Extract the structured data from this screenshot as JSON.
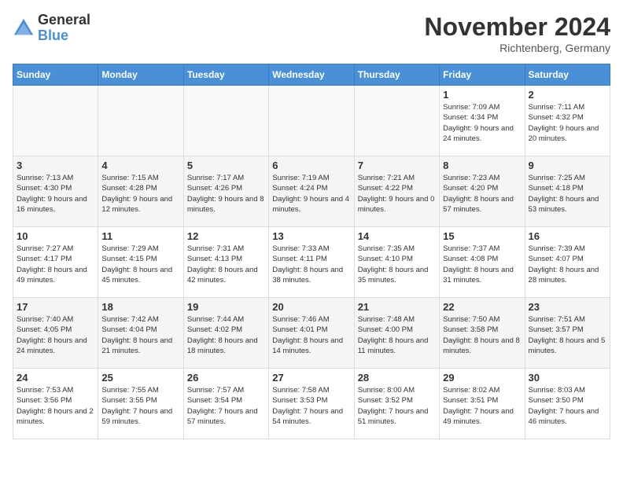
{
  "logo": {
    "general": "General",
    "blue": "Blue"
  },
  "title": "November 2024",
  "location": "Richtenberg, Germany",
  "days_header": [
    "Sunday",
    "Monday",
    "Tuesday",
    "Wednesday",
    "Thursday",
    "Friday",
    "Saturday"
  ],
  "weeks": [
    {
      "days": [
        {
          "num": "",
          "empty": true
        },
        {
          "num": "",
          "empty": true
        },
        {
          "num": "",
          "empty": true
        },
        {
          "num": "",
          "empty": true
        },
        {
          "num": "",
          "empty": true
        },
        {
          "num": "1",
          "sunrise": "Sunrise: 7:09 AM",
          "sunset": "Sunset: 4:34 PM",
          "daylight": "Daylight: 9 hours and 24 minutes."
        },
        {
          "num": "2",
          "sunrise": "Sunrise: 7:11 AM",
          "sunset": "Sunset: 4:32 PM",
          "daylight": "Daylight: 9 hours and 20 minutes."
        }
      ]
    },
    {
      "days": [
        {
          "num": "3",
          "sunrise": "Sunrise: 7:13 AM",
          "sunset": "Sunset: 4:30 PM",
          "daylight": "Daylight: 9 hours and 16 minutes."
        },
        {
          "num": "4",
          "sunrise": "Sunrise: 7:15 AM",
          "sunset": "Sunset: 4:28 PM",
          "daylight": "Daylight: 9 hours and 12 minutes."
        },
        {
          "num": "5",
          "sunrise": "Sunrise: 7:17 AM",
          "sunset": "Sunset: 4:26 PM",
          "daylight": "Daylight: 9 hours and 8 minutes."
        },
        {
          "num": "6",
          "sunrise": "Sunrise: 7:19 AM",
          "sunset": "Sunset: 4:24 PM",
          "daylight": "Daylight: 9 hours and 4 minutes."
        },
        {
          "num": "7",
          "sunrise": "Sunrise: 7:21 AM",
          "sunset": "Sunset: 4:22 PM",
          "daylight": "Daylight: 9 hours and 0 minutes."
        },
        {
          "num": "8",
          "sunrise": "Sunrise: 7:23 AM",
          "sunset": "Sunset: 4:20 PM",
          "daylight": "Daylight: 8 hours and 57 minutes."
        },
        {
          "num": "9",
          "sunrise": "Sunrise: 7:25 AM",
          "sunset": "Sunset: 4:18 PM",
          "daylight": "Daylight: 8 hours and 53 minutes."
        }
      ]
    },
    {
      "days": [
        {
          "num": "10",
          "sunrise": "Sunrise: 7:27 AM",
          "sunset": "Sunset: 4:17 PM",
          "daylight": "Daylight: 8 hours and 49 minutes."
        },
        {
          "num": "11",
          "sunrise": "Sunrise: 7:29 AM",
          "sunset": "Sunset: 4:15 PM",
          "daylight": "Daylight: 8 hours and 45 minutes."
        },
        {
          "num": "12",
          "sunrise": "Sunrise: 7:31 AM",
          "sunset": "Sunset: 4:13 PM",
          "daylight": "Daylight: 8 hours and 42 minutes."
        },
        {
          "num": "13",
          "sunrise": "Sunrise: 7:33 AM",
          "sunset": "Sunset: 4:11 PM",
          "daylight": "Daylight: 8 hours and 38 minutes."
        },
        {
          "num": "14",
          "sunrise": "Sunrise: 7:35 AM",
          "sunset": "Sunset: 4:10 PM",
          "daylight": "Daylight: 8 hours and 35 minutes."
        },
        {
          "num": "15",
          "sunrise": "Sunrise: 7:37 AM",
          "sunset": "Sunset: 4:08 PM",
          "daylight": "Daylight: 8 hours and 31 minutes."
        },
        {
          "num": "16",
          "sunrise": "Sunrise: 7:39 AM",
          "sunset": "Sunset: 4:07 PM",
          "daylight": "Daylight: 8 hours and 28 minutes."
        }
      ]
    },
    {
      "days": [
        {
          "num": "17",
          "sunrise": "Sunrise: 7:40 AM",
          "sunset": "Sunset: 4:05 PM",
          "daylight": "Daylight: 8 hours and 24 minutes."
        },
        {
          "num": "18",
          "sunrise": "Sunrise: 7:42 AM",
          "sunset": "Sunset: 4:04 PM",
          "daylight": "Daylight: 8 hours and 21 minutes."
        },
        {
          "num": "19",
          "sunrise": "Sunrise: 7:44 AM",
          "sunset": "Sunset: 4:02 PM",
          "daylight": "Daylight: 8 hours and 18 minutes."
        },
        {
          "num": "20",
          "sunrise": "Sunrise: 7:46 AM",
          "sunset": "Sunset: 4:01 PM",
          "daylight": "Daylight: 8 hours and 14 minutes."
        },
        {
          "num": "21",
          "sunrise": "Sunrise: 7:48 AM",
          "sunset": "Sunset: 4:00 PM",
          "daylight": "Daylight: 8 hours and 11 minutes."
        },
        {
          "num": "22",
          "sunrise": "Sunrise: 7:50 AM",
          "sunset": "Sunset: 3:58 PM",
          "daylight": "Daylight: 8 hours and 8 minutes."
        },
        {
          "num": "23",
          "sunrise": "Sunrise: 7:51 AM",
          "sunset": "Sunset: 3:57 PM",
          "daylight": "Daylight: 8 hours and 5 minutes."
        }
      ]
    },
    {
      "days": [
        {
          "num": "24",
          "sunrise": "Sunrise: 7:53 AM",
          "sunset": "Sunset: 3:56 PM",
          "daylight": "Daylight: 8 hours and 2 minutes."
        },
        {
          "num": "25",
          "sunrise": "Sunrise: 7:55 AM",
          "sunset": "Sunset: 3:55 PM",
          "daylight": "Daylight: 7 hours and 59 minutes."
        },
        {
          "num": "26",
          "sunrise": "Sunrise: 7:57 AM",
          "sunset": "Sunset: 3:54 PM",
          "daylight": "Daylight: 7 hours and 57 minutes."
        },
        {
          "num": "27",
          "sunrise": "Sunrise: 7:58 AM",
          "sunset": "Sunset: 3:53 PM",
          "daylight": "Daylight: 7 hours and 54 minutes."
        },
        {
          "num": "28",
          "sunrise": "Sunrise: 8:00 AM",
          "sunset": "Sunset: 3:52 PM",
          "daylight": "Daylight: 7 hours and 51 minutes."
        },
        {
          "num": "29",
          "sunrise": "Sunrise: 8:02 AM",
          "sunset": "Sunset: 3:51 PM",
          "daylight": "Daylight: 7 hours and 49 minutes."
        },
        {
          "num": "30",
          "sunrise": "Sunrise: 8:03 AM",
          "sunset": "Sunset: 3:50 PM",
          "daylight": "Daylight: 7 hours and 46 minutes."
        }
      ]
    }
  ]
}
